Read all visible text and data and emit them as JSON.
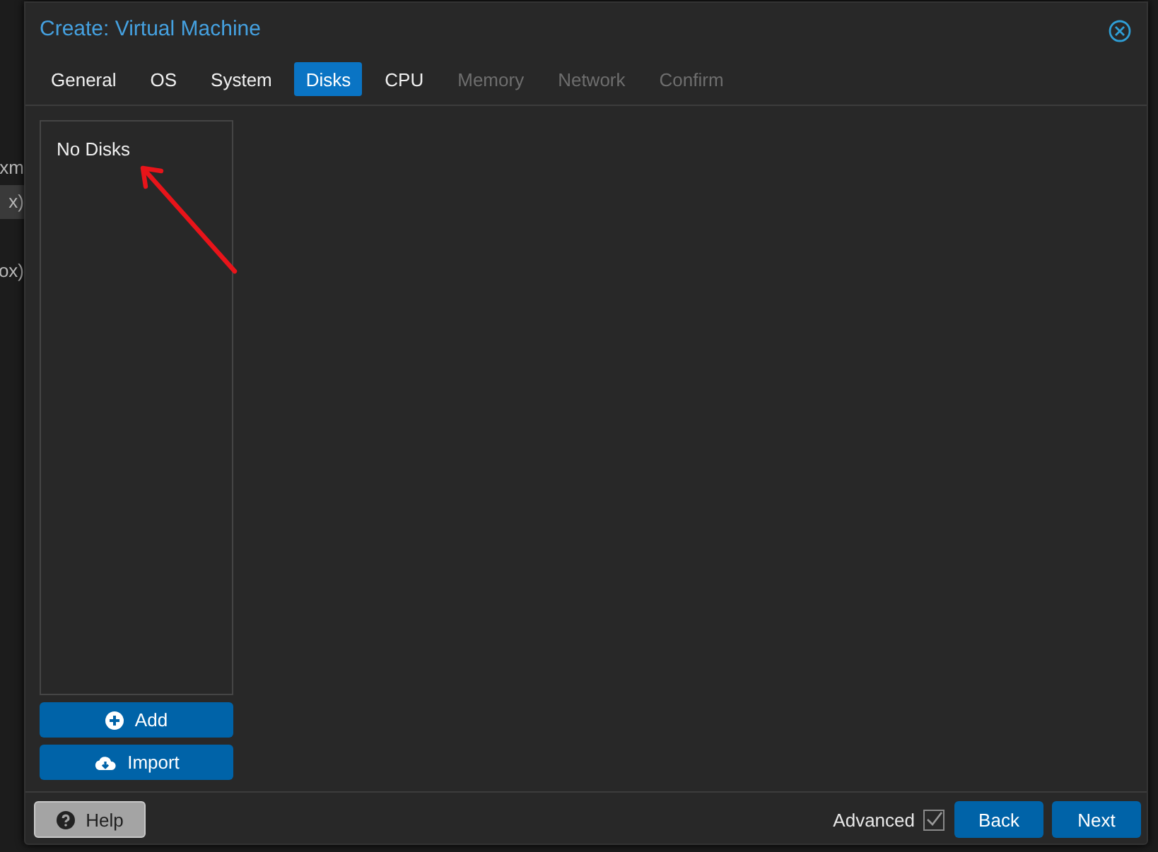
{
  "background": {
    "fragments": [
      {
        "text": "xm",
        "selected": false
      },
      {
        "text": "x)",
        "selected": true
      },
      {
        "text": "ox)",
        "selected": false
      }
    ]
  },
  "window": {
    "title": "Create: Virtual Machine"
  },
  "tabs": [
    {
      "label": "General",
      "selected": false,
      "disabled": false
    },
    {
      "label": "OS",
      "selected": false,
      "disabled": false
    },
    {
      "label": "System",
      "selected": false,
      "disabled": false
    },
    {
      "label": "Disks",
      "selected": true,
      "disabled": false
    },
    {
      "label": "CPU",
      "selected": false,
      "disabled": false
    },
    {
      "label": "Memory",
      "selected": false,
      "disabled": true
    },
    {
      "label": "Network",
      "selected": false,
      "disabled": true
    },
    {
      "label": "Confirm",
      "selected": false,
      "disabled": true
    }
  ],
  "disk_list": {
    "empty_text": "No Disks"
  },
  "annotation": {
    "kind": "arrow"
  },
  "disk_buttons": [
    {
      "label": "Add",
      "kind": "add"
    },
    {
      "label": "Import",
      "kind": "import"
    }
  ],
  "footer": {
    "help": "Help",
    "advanced": {
      "label": "Advanced",
      "checked": true
    },
    "buttons": [
      "Back",
      "Next"
    ]
  }
}
